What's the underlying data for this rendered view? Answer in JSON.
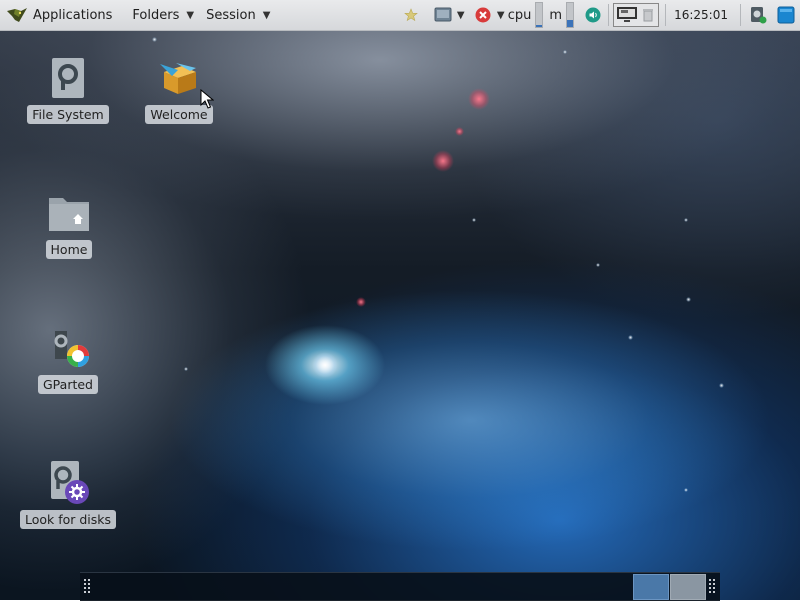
{
  "top_panel": {
    "applications_label": "Applications",
    "folders_label": "Folders",
    "session_label": "Session",
    "cpu_label": "cpu",
    "mem_label": "m",
    "clock": "16:25:01",
    "cpu_level_pct": 10,
    "mem_level_pct": 30
  },
  "desktop_icons": {
    "file_system": "File System",
    "welcome": "Welcome",
    "home": "Home",
    "gparted": "GParted",
    "look_for_disks": "Look for disks"
  },
  "colors": {
    "panel_bg": "#dcdee1",
    "workspace_active": "#4a78a8",
    "workspace_inactive": "#8a96a2",
    "close_badge": "#d83b3b"
  },
  "bottom_panel": {
    "workspaces": [
      "workspace-1",
      "workspace-2"
    ],
    "active_workspace": 1
  }
}
